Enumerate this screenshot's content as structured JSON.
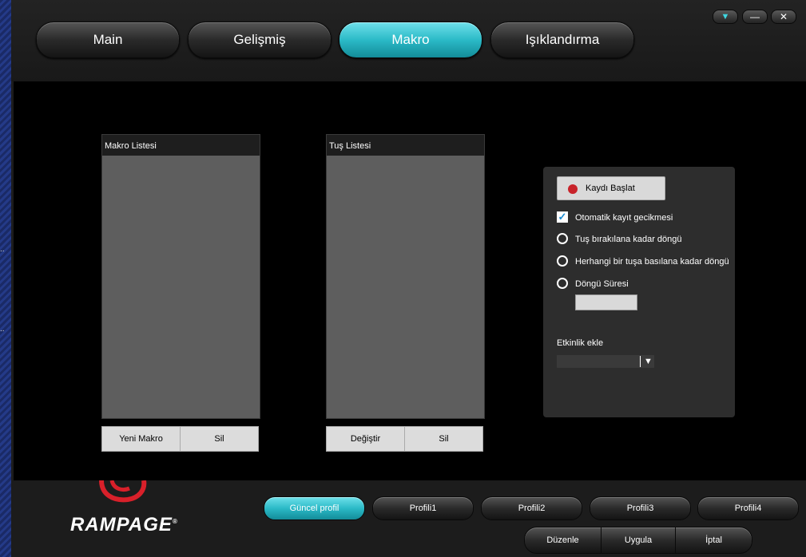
{
  "window": {
    "menu_icon": "triangle-down-icon",
    "minimize_icon": "minimize-icon",
    "close_icon": "close-icon",
    "menu_glyph": "▼",
    "minimize_glyph": "—",
    "close_glyph": "✕"
  },
  "tabs": [
    {
      "label": "Main",
      "active": false
    },
    {
      "label": "Gelişmiş",
      "active": false
    },
    {
      "label": "Makro",
      "active": true
    },
    {
      "label": "Işıklandırma",
      "active": false
    }
  ],
  "macro_list": {
    "header": "Makro Listesi",
    "new_button": "Yeni Makro",
    "delete_button": "Sil"
  },
  "key_list": {
    "header": "Tuş Listesi",
    "change_button": "Değiştir",
    "delete_button": "Sil"
  },
  "options": {
    "record_button": "Kaydı Başlat",
    "auto_delay": {
      "label": "Otomatik kayıt gecikmesi",
      "checked": true
    },
    "radios": [
      {
        "label": "Tuş bırakılana kadar döngü"
      },
      {
        "label": "Herhangi bir tuşa basılana kadar döngü"
      },
      {
        "label": "Döngü Süresi"
      }
    ],
    "loop_duration_value": "",
    "add_event_label": "Etkinlik ekle",
    "add_event_value": ""
  },
  "brand": {
    "logo_text": "RAMPAGE",
    "registered": "®",
    "accent_color": "#d8202a"
  },
  "profiles": [
    {
      "label": "Güncel profil",
      "active": true
    },
    {
      "label": "Profili1",
      "active": false
    },
    {
      "label": "Profili2",
      "active": false
    },
    {
      "label": "Profili3",
      "active": false
    },
    {
      "label": "Profili4",
      "active": false
    }
  ],
  "actions": {
    "edit": "Düzenle",
    "apply": "Uygula",
    "cancel": "İptal"
  },
  "colors": {
    "accent": "#2bbac7",
    "record_dot": "#c8232a"
  }
}
